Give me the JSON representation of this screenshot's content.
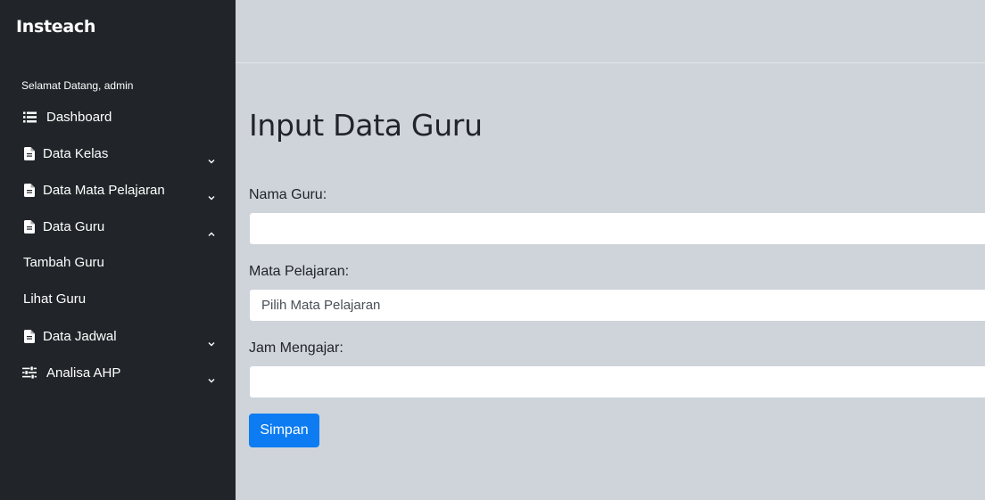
{
  "app": {
    "brand": "Insteach"
  },
  "sidebar": {
    "welcome": "Selamat Datang, admin",
    "items": [
      {
        "label": "Dashboard",
        "icon": "list-icon"
      },
      {
        "label": "Data Kelas",
        "icon": "file-icon",
        "expanded": false
      },
      {
        "label": "Data Mata Pelajaran",
        "icon": "file-icon",
        "expanded": false
      },
      {
        "label": "Data Guru",
        "icon": "file-icon",
        "expanded": true
      },
      {
        "label": "Data Jadwal",
        "icon": "file-icon",
        "expanded": false
      },
      {
        "label": "Analisa AHP",
        "icon": "sliders-icon",
        "expanded": false
      }
    ],
    "sub_items": [
      {
        "label": "Tambah Guru"
      },
      {
        "label": "Lihat Guru"
      }
    ]
  },
  "main": {
    "title": "Input Data Guru",
    "form": {
      "nama_label": "Nama Guru:",
      "nama_value": "",
      "mapel_label": "Mata Pelajaran:",
      "mapel_selected": "Pilih Mata Pelajaran",
      "jam_label": "Jam Mengajar:",
      "jam_value": "",
      "submit_label": "Simpan"
    }
  },
  "colors": {
    "sidebar_bg": "#212529",
    "content_bg": "#cfd4db",
    "primary": "#0d7cf2"
  }
}
